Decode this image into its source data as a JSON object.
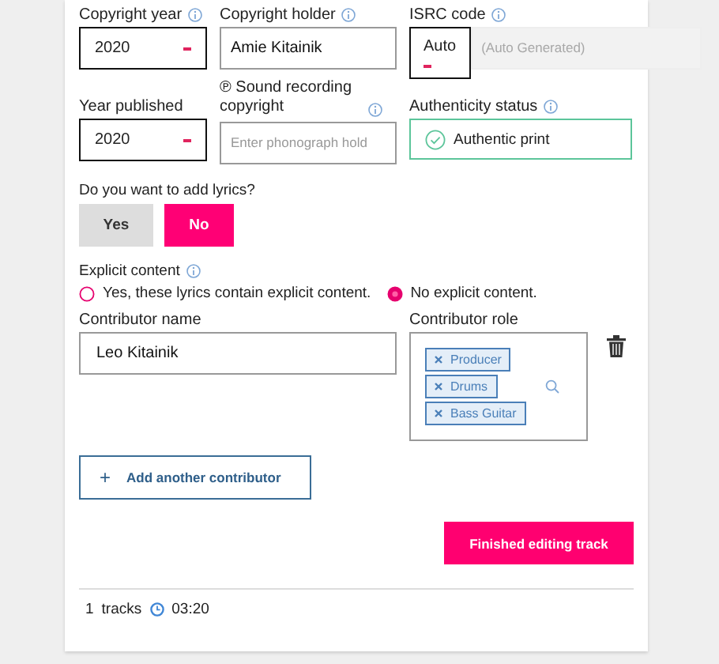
{
  "rows": [
    [
      {
        "kind": "select",
        "label": "Copyright year",
        "info": true,
        "value": "2020"
      },
      {
        "kind": "input",
        "label": "Copyright holder",
        "info": true,
        "value": "Amie Kitainik"
      },
      {
        "kind": "isrc",
        "label": "ISRC code",
        "info": true,
        "value": "Auto",
        "placeholder": "(Auto Generated)"
      }
    ],
    [
      {
        "kind": "select",
        "label": "Year published",
        "info": false,
        "value": "2020"
      },
      {
        "kind": "input",
        "label": "℗ Sound recording copyright",
        "info": true,
        "placeholder": "Enter phonograph hold"
      },
      {
        "kind": "status",
        "label": "Authenticity status",
        "info": true,
        "value": "Authentic print"
      }
    ]
  ],
  "lyrics": {
    "question": "Do you want to add lyrics?",
    "options": [
      {
        "label": "Yes",
        "selected": false
      },
      {
        "label": "No",
        "selected": true
      }
    ]
  },
  "explicit": {
    "label": "Explicit content",
    "info": true,
    "options": [
      {
        "label": "Yes, these lyrics contain explicit content.",
        "selected": false
      },
      {
        "label": "No explicit content.",
        "selected": true
      }
    ]
  },
  "contributor": {
    "name_label": "Contributor name",
    "name": "Leo Kitainik",
    "role_label": "Contributor role",
    "roles": [
      "Producer",
      "Drums",
      "Bass Guitar"
    ]
  },
  "add_button": {
    "icon": "+",
    "label": "Add another contributor"
  },
  "finish_button": "Finished editing track",
  "footer": {
    "count": "1",
    "unit": "tracks",
    "duration": "03:20"
  }
}
